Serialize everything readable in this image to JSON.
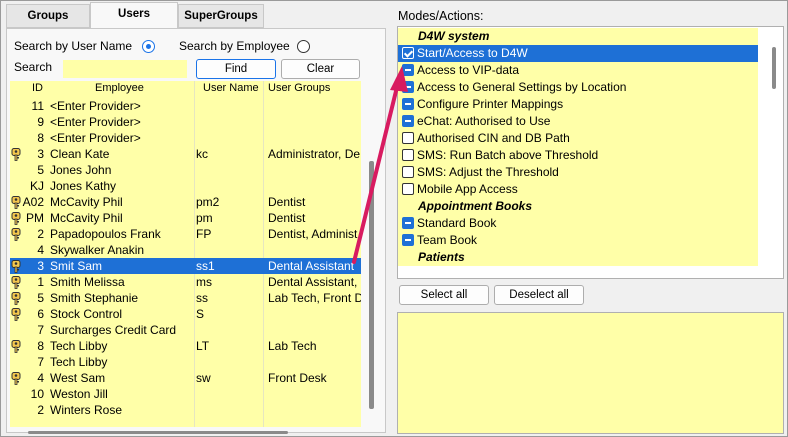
{
  "tabs": [
    {
      "label": "Groups",
      "active": false
    },
    {
      "label": "Users",
      "active": true
    },
    {
      "label": "SuperGroups",
      "active": false
    }
  ],
  "search": {
    "by_user_name_label": "Search by User Name",
    "by_employee_label": "Search by Employee",
    "selected_mode": "user_name",
    "search_label": "Search",
    "search_value": "",
    "find_label": "Find",
    "clear_label": "Clear"
  },
  "grid": {
    "columns": [
      "ID",
      "Employee",
      "User Name",
      "User Groups"
    ],
    "rows": [
      {
        "key": false,
        "id": "11",
        "employee": "<Enter Provider>",
        "user_name": "",
        "groups": ""
      },
      {
        "key": false,
        "id": "9",
        "employee": "<Enter Provider>",
        "user_name": "",
        "groups": ""
      },
      {
        "key": false,
        "id": "8",
        "employee": "<Enter Provider>",
        "user_name": "",
        "groups": ""
      },
      {
        "key": true,
        "id": "3",
        "employee": "Clean Kate",
        "user_name": "kc",
        "groups": "Administrator, De"
      },
      {
        "key": false,
        "id": "5",
        "employee": "Jones John",
        "user_name": "",
        "groups": ""
      },
      {
        "key": false,
        "id": "KJ",
        "employee": "Jones Kathy",
        "user_name": "",
        "groups": ""
      },
      {
        "key": true,
        "id": "A02",
        "employee": "McCavity Phil",
        "user_name": "pm2",
        "groups": "Dentist"
      },
      {
        "key": true,
        "id": "PM",
        "employee": "McCavity Phil",
        "user_name": "pm",
        "groups": "Dentist"
      },
      {
        "key": true,
        "id": "2",
        "employee": "Papadopoulos Frank",
        "user_name": "FP",
        "groups": "Dentist, Administ"
      },
      {
        "key": false,
        "id": "4",
        "employee": "Skywalker Anakin",
        "user_name": "",
        "groups": ""
      },
      {
        "key": true,
        "id": "3",
        "employee": "Smit Sam",
        "user_name": "ss1",
        "groups": "Dental Assistant",
        "selected": true
      },
      {
        "key": true,
        "id": "1",
        "employee": "Smith Melissa",
        "user_name": "ms",
        "groups": "Dental Assistant,"
      },
      {
        "key": true,
        "id": "5",
        "employee": "Smith Stephanie",
        "user_name": "ss",
        "groups": "Lab Tech, Front D"
      },
      {
        "key": true,
        "id": "6",
        "employee": "Stock  Control",
        "user_name": "S",
        "groups": ""
      },
      {
        "key": false,
        "id": "7",
        "employee": "Surcharges Credit Card",
        "user_name": "",
        "groups": ""
      },
      {
        "key": true,
        "id": "8",
        "employee": "Tech Libby",
        "user_name": "LT",
        "groups": "Lab Tech"
      },
      {
        "key": false,
        "id": "7",
        "employee": "Tech Libby",
        "user_name": "",
        "groups": ""
      },
      {
        "key": true,
        "id": "4",
        "employee": "West Sam",
        "user_name": "sw",
        "groups": "Front Desk"
      },
      {
        "key": false,
        "id": "10",
        "employee": "Weston Jill",
        "user_name": "",
        "groups": ""
      },
      {
        "key": false,
        "id": "2",
        "employee": "Winters Rose",
        "user_name": "",
        "groups": ""
      }
    ]
  },
  "modes": {
    "label": "Modes/Actions:",
    "items": [
      {
        "type": "header",
        "label": "D4W system"
      },
      {
        "type": "item",
        "state": "checked",
        "label": "Start/Access to D4W",
        "selected": true
      },
      {
        "type": "item",
        "state": "minus",
        "label": "Access to VIP-data"
      },
      {
        "type": "item",
        "state": "minus",
        "label": "Access to General Settings by Location"
      },
      {
        "type": "item",
        "state": "minus",
        "label": "Configure Printer Mappings"
      },
      {
        "type": "item",
        "state": "minus",
        "label": "eChat: Authorised to Use"
      },
      {
        "type": "item",
        "state": "empty",
        "label": "Authorised CIN and DB Path"
      },
      {
        "type": "item",
        "state": "empty",
        "label": "SMS: Run Batch above Threshold"
      },
      {
        "type": "item",
        "state": "empty",
        "label": "SMS: Adjust the Threshold"
      },
      {
        "type": "item",
        "state": "empty",
        "label": "Mobile App Access"
      },
      {
        "type": "header",
        "label": "Appointment Books"
      },
      {
        "type": "item",
        "state": "minus",
        "label": "Standard Book"
      },
      {
        "type": "item",
        "state": "minus",
        "label": "Team Book"
      },
      {
        "type": "header",
        "label": "Patients"
      }
    ]
  },
  "actions": {
    "select_all": "Select all",
    "deselect_all": "Deselect all"
  },
  "colors": {
    "row_background": "#ffffa8",
    "selection": "#1e70d6",
    "arrow": "#d81b60"
  }
}
